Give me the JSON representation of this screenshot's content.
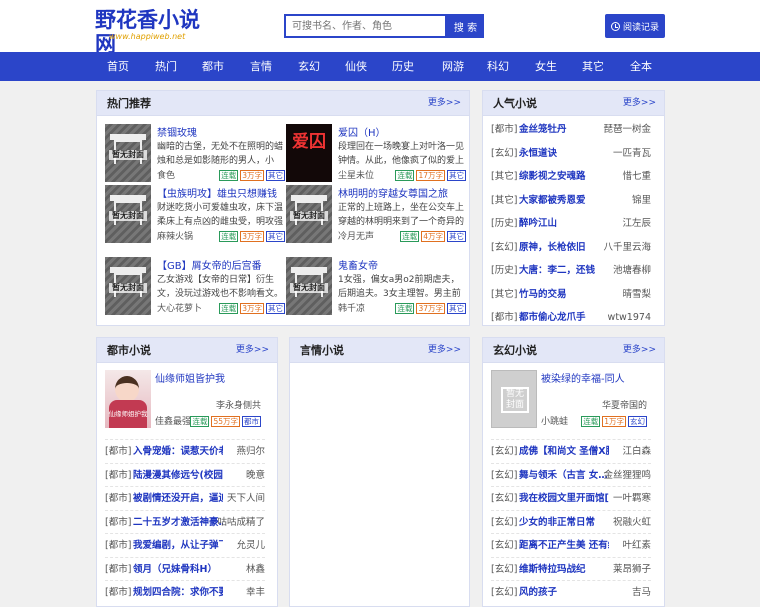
{
  "site": {
    "name": "野花香小说网",
    "url": "www.happiweb.net"
  },
  "search": {
    "placeholder": "可搜书名、作者、角色",
    "button": "搜 索"
  },
  "read_record": "阅读记录",
  "nav": [
    "首页",
    "热门",
    "都市",
    "言情",
    "玄幻",
    "仙侠",
    "历史",
    "网游",
    "科幻",
    "女生",
    "其它",
    "全本"
  ],
  "hot": {
    "title": "热门推荐",
    "more": "更多>>",
    "items": [
      {
        "name": "禁锢玫瑰",
        "desc": "幽暗的古堡，无处不在照明的蜡烛和总是如影随形的男人，小",
        "author": "食色",
        "tags": [
          "连载",
          "3万字",
          "其它"
        ],
        "cover": "暂无封面"
      },
      {
        "name": "爱囚（H）",
        "desc": "段理回在一场晚宴上对叶洛一见钟情。从此，他像疯了似的爱上",
        "author": "尘星未位",
        "tags": [
          "连载",
          "17万字",
          "其它"
        ],
        "cover": "爱囚"
      },
      {
        "name": "【虫族明攻】雄虫只想赚钱",
        "desc": "财迷吃货小可爱雄虫攻，床下温柔床上有点凶的雌虫受，明攻强受，",
        "author": "麻辣火锅",
        "tags": [
          "连载",
          "3万字",
          "其它"
        ],
        "cover": "暂无封面"
      },
      {
        "name": "林明明的穿越女尊国之旅",
        "desc": "正常的上班路上，坐在公交车上穿越的林明明来到了一个奇异的",
        "author": "冷月无声",
        "tags": [
          "连载",
          "4万字",
          "其它"
        ],
        "cover": "暂无封面"
      },
      {
        "name": "【GB】屑女帝的后宫番",
        "desc": "乙女游戏【女帝的日常】衍生文，没玩过游戏也不影响看文。",
        "author": "大心花萝卜",
        "tags": [
          "连载",
          "3万字",
          "其它"
        ],
        "cover": "暂无封面"
      },
      {
        "name": "鬼畜女帝",
        "desc": "1女强，偏女a男o2前期虐夫，后期追夫。3女主理智。男主前期",
        "author": "韩千凉",
        "tags": [
          "连载",
          "37万字",
          "其它"
        ],
        "cover": "暂无封面"
      }
    ]
  },
  "popular": {
    "title": "人气小说",
    "more": "更多>>",
    "items": [
      {
        "cat": "[都市]",
        "name": "金丝笼牡丹",
        "author": "琵琶一树金"
      },
      {
        "cat": "[玄幻]",
        "name": "永恒道诀",
        "author": "一匹青瓦"
      },
      {
        "cat": "[其它]",
        "name": "综影视之安魂路",
        "author": "惜七重"
      },
      {
        "cat": "[其它]",
        "name": "大家都被秀恩爱",
        "author": "锦里"
      },
      {
        "cat": "[历史]",
        "name": "醉吟江山",
        "author": "江左辰"
      },
      {
        "cat": "[玄幻]",
        "name": "原神，长枪依旧",
        "author": "八千里云海"
      },
      {
        "cat": "[历史]",
        "name": "大唐：李二，还钱",
        "author": "池塘春柳"
      },
      {
        "cat": "[其它]",
        "name": "竹马的交易",
        "author": "晴雪梨"
      },
      {
        "cat": "[都市]",
        "name": "都市偷心龙爪手",
        "author": "wtw1974"
      }
    ]
  },
  "urban": {
    "title": "都市小说",
    "more": "更多>>",
    "feature": {
      "name": "仙缘师姐皆护我",
      "author": "李永身侧共",
      "bottom_author": "佳鑫最强",
      "tags": [
        "连载",
        "55万字",
        "都市"
      ],
      "cover": "仙缘师姐护我"
    },
    "items": [
      {
        "cat": "[都市]",
        "name": "入骨宠婚：误惹天价老公",
        "author": "燕归尔"
      },
      {
        "cat": "[都市]",
        "name": "陆漫漫其修远兮(校园 1v1)",
        "author": "晚意"
      },
      {
        "cat": "[都市]",
        "name": "被剧情还没开启，逼迫…",
        "author": "天下人间"
      },
      {
        "cat": "[都市]",
        "name": "二十五岁才激活神豪…",
        "author": "咕咕成精了"
      },
      {
        "cat": "[都市]",
        "name": "我爱编剧，从让子弹飞…",
        "author": "允灵儿"
      },
      {
        "cat": "[都市]",
        "name": "领月（兄妹骨科H）",
        "author": "林鑫"
      },
      {
        "cat": "[都市]",
        "name": "规划四合院：求你不要过来…",
        "author": "幸丰"
      }
    ]
  },
  "romance": {
    "title": "言情小说",
    "more": "更多>>"
  },
  "fantasy": {
    "title": "玄幻小说",
    "more": "更多>>",
    "feature": {
      "name": "被染绿的幸福-同人",
      "author": "华夏帝国的",
      "bottom_author": "小跳蛙",
      "tags": [
        "连载",
        "1万字",
        "玄幻"
      ],
      "cover": "暂无封面"
    },
    "items": [
      {
        "cat": "[玄幻]",
        "name": "成佛【和尚文 圣僧X腰…】",
        "author": "江白森"
      },
      {
        "cat": "[玄幻]",
        "name": "舞与领禾（古言 女…",
        "author": "金丝狸狸鸣"
      },
      {
        "cat": "[玄幻]",
        "name": "我在校园文里开面馆[美…",
        "author": "一叶羁寒"
      },
      {
        "cat": "[玄幻]",
        "name": "少女的非正常日常",
        "author": "祝融火虹"
      },
      {
        "cat": "[玄幻]",
        "name": "距离不正产生美 还有绿",
        "author": "叶红素"
      },
      {
        "cat": "[玄幻]",
        "name": "维斯特拉玛战纪",
        "author": "莱昂狮子"
      },
      {
        "cat": "[玄幻]",
        "name": "风的孩子",
        "author": "吉马"
      }
    ]
  },
  "colors": {
    "primary": "#2b45c9",
    "panel_header": "#e3e7f7",
    "tag_green": "#2a9a5a",
    "tag_orange": "#e07020"
  }
}
